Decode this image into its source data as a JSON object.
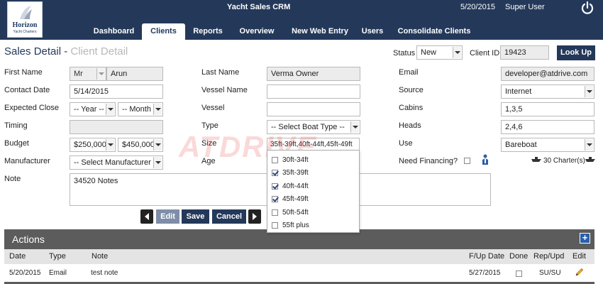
{
  "header": {
    "app_title": "Yacht Sales CRM",
    "date": "5/20/2015",
    "user": "Super User",
    "logo_name": "Horizon",
    "logo_sub": "Yacht Charters"
  },
  "nav": {
    "items": [
      {
        "label": "Dashboard",
        "active": false
      },
      {
        "label": "Clients",
        "active": true
      },
      {
        "label": "Reports",
        "active": false
      },
      {
        "label": "Overview",
        "active": false
      },
      {
        "label": "New Web Entry",
        "active": false
      },
      {
        "label": "Users",
        "active": false
      },
      {
        "label": "Consolidate Clients",
        "active": false
      }
    ]
  },
  "page": {
    "title_main": "Sales Detail - ",
    "title_sub": "Client Detail",
    "status_label": "Status",
    "status_value": "New",
    "client_id_label": "Client ID :",
    "client_id_value": "19423",
    "lookup_button": "Look Up"
  },
  "form": {
    "first_name_label": "First Name",
    "salutation": "Mr",
    "first_name": "Arun",
    "contact_date_label": "Contact Date",
    "contact_date": "5/14/2015",
    "expected_close_label": "Expected Close",
    "year_select": "-- Year --",
    "month_select": "-- Month --",
    "timing_label": "Timing",
    "timing": "",
    "budget_label": "Budget",
    "budget_min": "$250,000",
    "budget_max": "$450,000",
    "manufacturer_label": "Manufacturer",
    "manufacturer_select": "-- Select Manufacturer --",
    "note_label": "Note",
    "note": "34520 Notes",
    "last_name_label": "Last Name",
    "last_name": "Verma Owner",
    "vessel_name_label": "Vessel Name",
    "vessel_name": "",
    "vessel_label": "Vessel",
    "vessel": "",
    "type_label": "Type",
    "type_select": "-- Select Boat Type --",
    "size_label": "Size",
    "size_value": "35ft-39ft,40ft-44ft,45ft-49ft",
    "age_label": "Age",
    "email_label": "Email",
    "email": "developer@atdrive.com",
    "source_label": "Source",
    "source": "Internet",
    "cabins_label": "Cabins",
    "cabins": "1,3,5",
    "heads_label": "Heads",
    "heads": "2,4,6",
    "use_label": "Use",
    "use": "Bareboat",
    "need_financing_label": "Need Financing?",
    "charters": "30 Charter(s)"
  },
  "size_options": [
    {
      "label": "30ft-34ft",
      "checked": false
    },
    {
      "label": "35ft-39ft",
      "checked": true
    },
    {
      "label": "40ft-44ft",
      "checked": true
    },
    {
      "label": "45ft-49ft",
      "checked": true
    },
    {
      "label": "50ft-54ft",
      "checked": false
    },
    {
      "label": "55ft plus",
      "checked": false
    }
  ],
  "buttons": {
    "edit": "Edit",
    "save": "Save",
    "cancel": "Cancel"
  },
  "watermark": "ATDRIVE",
  "actions": {
    "title": "Actions",
    "add": "+",
    "columns": [
      "Date",
      "Type",
      "Note",
      "F/Up Date",
      "Done",
      "Rep/Upd",
      "Edit"
    ],
    "rows": [
      {
        "date": "5/20/2015",
        "type": "Email",
        "note": "test note",
        "fup_date": "5/27/2015",
        "done": false,
        "rep": "SU/SU"
      }
    ]
  },
  "colors": {
    "header_bg": "#24395a",
    "actions_bg": "#5c5c5c",
    "accent_blue": "#2a5fa8"
  }
}
